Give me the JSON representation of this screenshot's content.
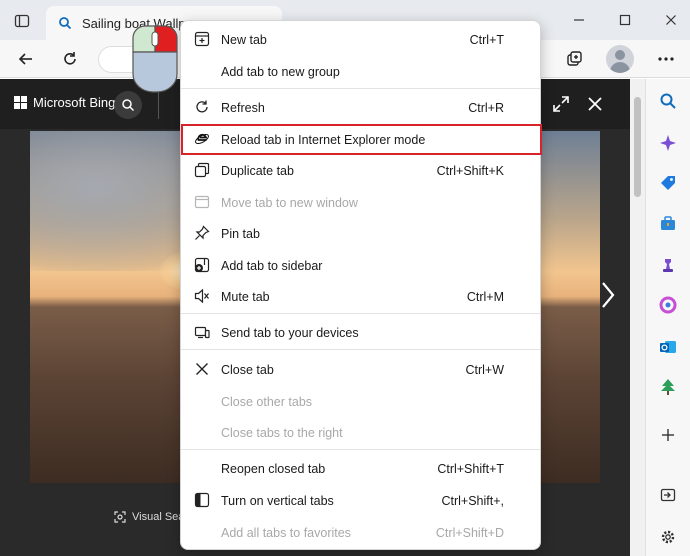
{
  "browser": {
    "active_tab_title": "Sailing boat Wallpa",
    "colors": {
      "titlebar": "#e7eaee",
      "accent": "#0f6cbd",
      "highlight": "#d9232b"
    }
  },
  "bing": {
    "logo_text": "Microsoft Bing",
    "visual_search_label": "Visual Sear"
  },
  "context_menu": {
    "items": [
      {
        "label": "New tab",
        "shortcut": "Ctrl+T",
        "icon": "new-tab-icon",
        "disabled": false
      },
      {
        "label": "Add tab to new group",
        "shortcut": "",
        "icon": "",
        "disabled": false
      },
      {
        "label": "Refresh",
        "shortcut": "Ctrl+R",
        "icon": "refresh-icon",
        "disabled": false
      },
      {
        "label": "Reload tab in Internet Explorer mode",
        "shortcut": "",
        "icon": "internet-explorer-icon",
        "disabled": false,
        "highlighted": true
      },
      {
        "label": "Duplicate tab",
        "shortcut": "Ctrl+Shift+K",
        "icon": "duplicate-tab-icon",
        "disabled": false
      },
      {
        "label": "Move tab to new window",
        "shortcut": "",
        "icon": "move-window-icon",
        "disabled": true
      },
      {
        "label": "Pin tab",
        "shortcut": "",
        "icon": "pin-icon",
        "disabled": false
      },
      {
        "label": "Add tab to sidebar",
        "shortcut": "",
        "icon": "sidebar-add-icon",
        "disabled": false
      },
      {
        "label": "Mute tab",
        "shortcut": "Ctrl+M",
        "icon": "mute-icon",
        "disabled": false
      },
      {
        "label": "Send tab to your devices",
        "shortcut": "",
        "icon": "devices-icon",
        "disabled": false
      },
      {
        "label": "Close tab",
        "shortcut": "Ctrl+W",
        "icon": "close-icon",
        "disabled": false
      },
      {
        "label": "Close other tabs",
        "shortcut": "",
        "icon": "",
        "disabled": true
      },
      {
        "label": "Close tabs to the right",
        "shortcut": "",
        "icon": "",
        "disabled": true
      },
      {
        "label": "Reopen closed tab",
        "shortcut": "Ctrl+Shift+T",
        "icon": "",
        "disabled": false
      },
      {
        "label": "Turn on vertical tabs",
        "shortcut": "Ctrl+Shift+,",
        "icon": "vertical-tabs-icon",
        "disabled": false
      },
      {
        "label": "Add all tabs to favorites",
        "shortcut": "Ctrl+Shift+D",
        "icon": "",
        "disabled": true
      }
    ]
  }
}
